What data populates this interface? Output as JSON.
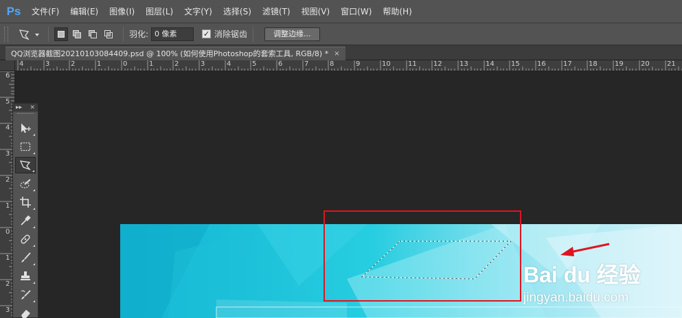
{
  "app": {
    "logo": "Ps"
  },
  "menu": [
    {
      "label": "文件(F)"
    },
    {
      "label": "编辑(E)"
    },
    {
      "label": "图像(I)"
    },
    {
      "label": "图层(L)"
    },
    {
      "label": "文字(Y)"
    },
    {
      "label": "选择(S)"
    },
    {
      "label": "滤镜(T)"
    },
    {
      "label": "视图(V)"
    },
    {
      "label": "窗口(W)"
    },
    {
      "label": "帮助(H)"
    }
  ],
  "options": {
    "feather_label": "羽化:",
    "feather_value": "0 像素",
    "antialias_label": "消除锯齿",
    "antialias_checked": "✓",
    "refine_edge_label": "调整边缘..."
  },
  "document": {
    "tab_title": "QQ浏览器截图20210103084409.psd @ 100% (如何使用Photoshop的套索工具, RGB/8) *",
    "tab_close": "×"
  },
  "ruler": {
    "h_labels": [
      "4",
      "3",
      "2",
      "1",
      "0",
      "1",
      "2",
      "3",
      "4",
      "5",
      "6",
      "7",
      "8",
      "9",
      "10",
      "11",
      "12",
      "13",
      "14",
      "15",
      "16",
      "17",
      "18",
      "19",
      "20",
      "21"
    ],
    "v_labels": [
      "6",
      "5",
      "4",
      "3",
      "2",
      "1",
      "0",
      "1",
      "2",
      "3"
    ]
  },
  "toolbox": {
    "head_expand": "▸▸",
    "head_close": "×",
    "tools": [
      {
        "name": "move-tool",
        "icon": "move-icon"
      },
      {
        "name": "marquee-tool",
        "icon": "rect-marquee-icon"
      },
      {
        "name": "polygonal-lasso-tool",
        "icon": "polygonal-lasso-icon"
      },
      {
        "name": "quick-selection-tool",
        "icon": "quick-selection-icon"
      },
      {
        "name": "crop-tool",
        "icon": "crop-icon"
      },
      {
        "name": "eyedropper-tool",
        "icon": "eyedropper-icon"
      },
      {
        "name": "healing-brush-tool",
        "icon": "bandage-icon"
      },
      {
        "name": "brush-tool",
        "icon": "brush-icon"
      },
      {
        "name": "clone-stamp-tool",
        "icon": "stamp-icon"
      },
      {
        "name": "history-brush-tool",
        "icon": "history-brush-icon"
      },
      {
        "name": "eraser-tool",
        "icon": "eraser-icon"
      }
    ]
  },
  "watermark": {
    "logo_text": "Bai du 经验",
    "url": "jingyan.baidu.com"
  },
  "colors": {
    "annotation_red": "#e0141e",
    "ps_blue": "#4ea7ff",
    "image_cyan": "#19c2dc"
  }
}
